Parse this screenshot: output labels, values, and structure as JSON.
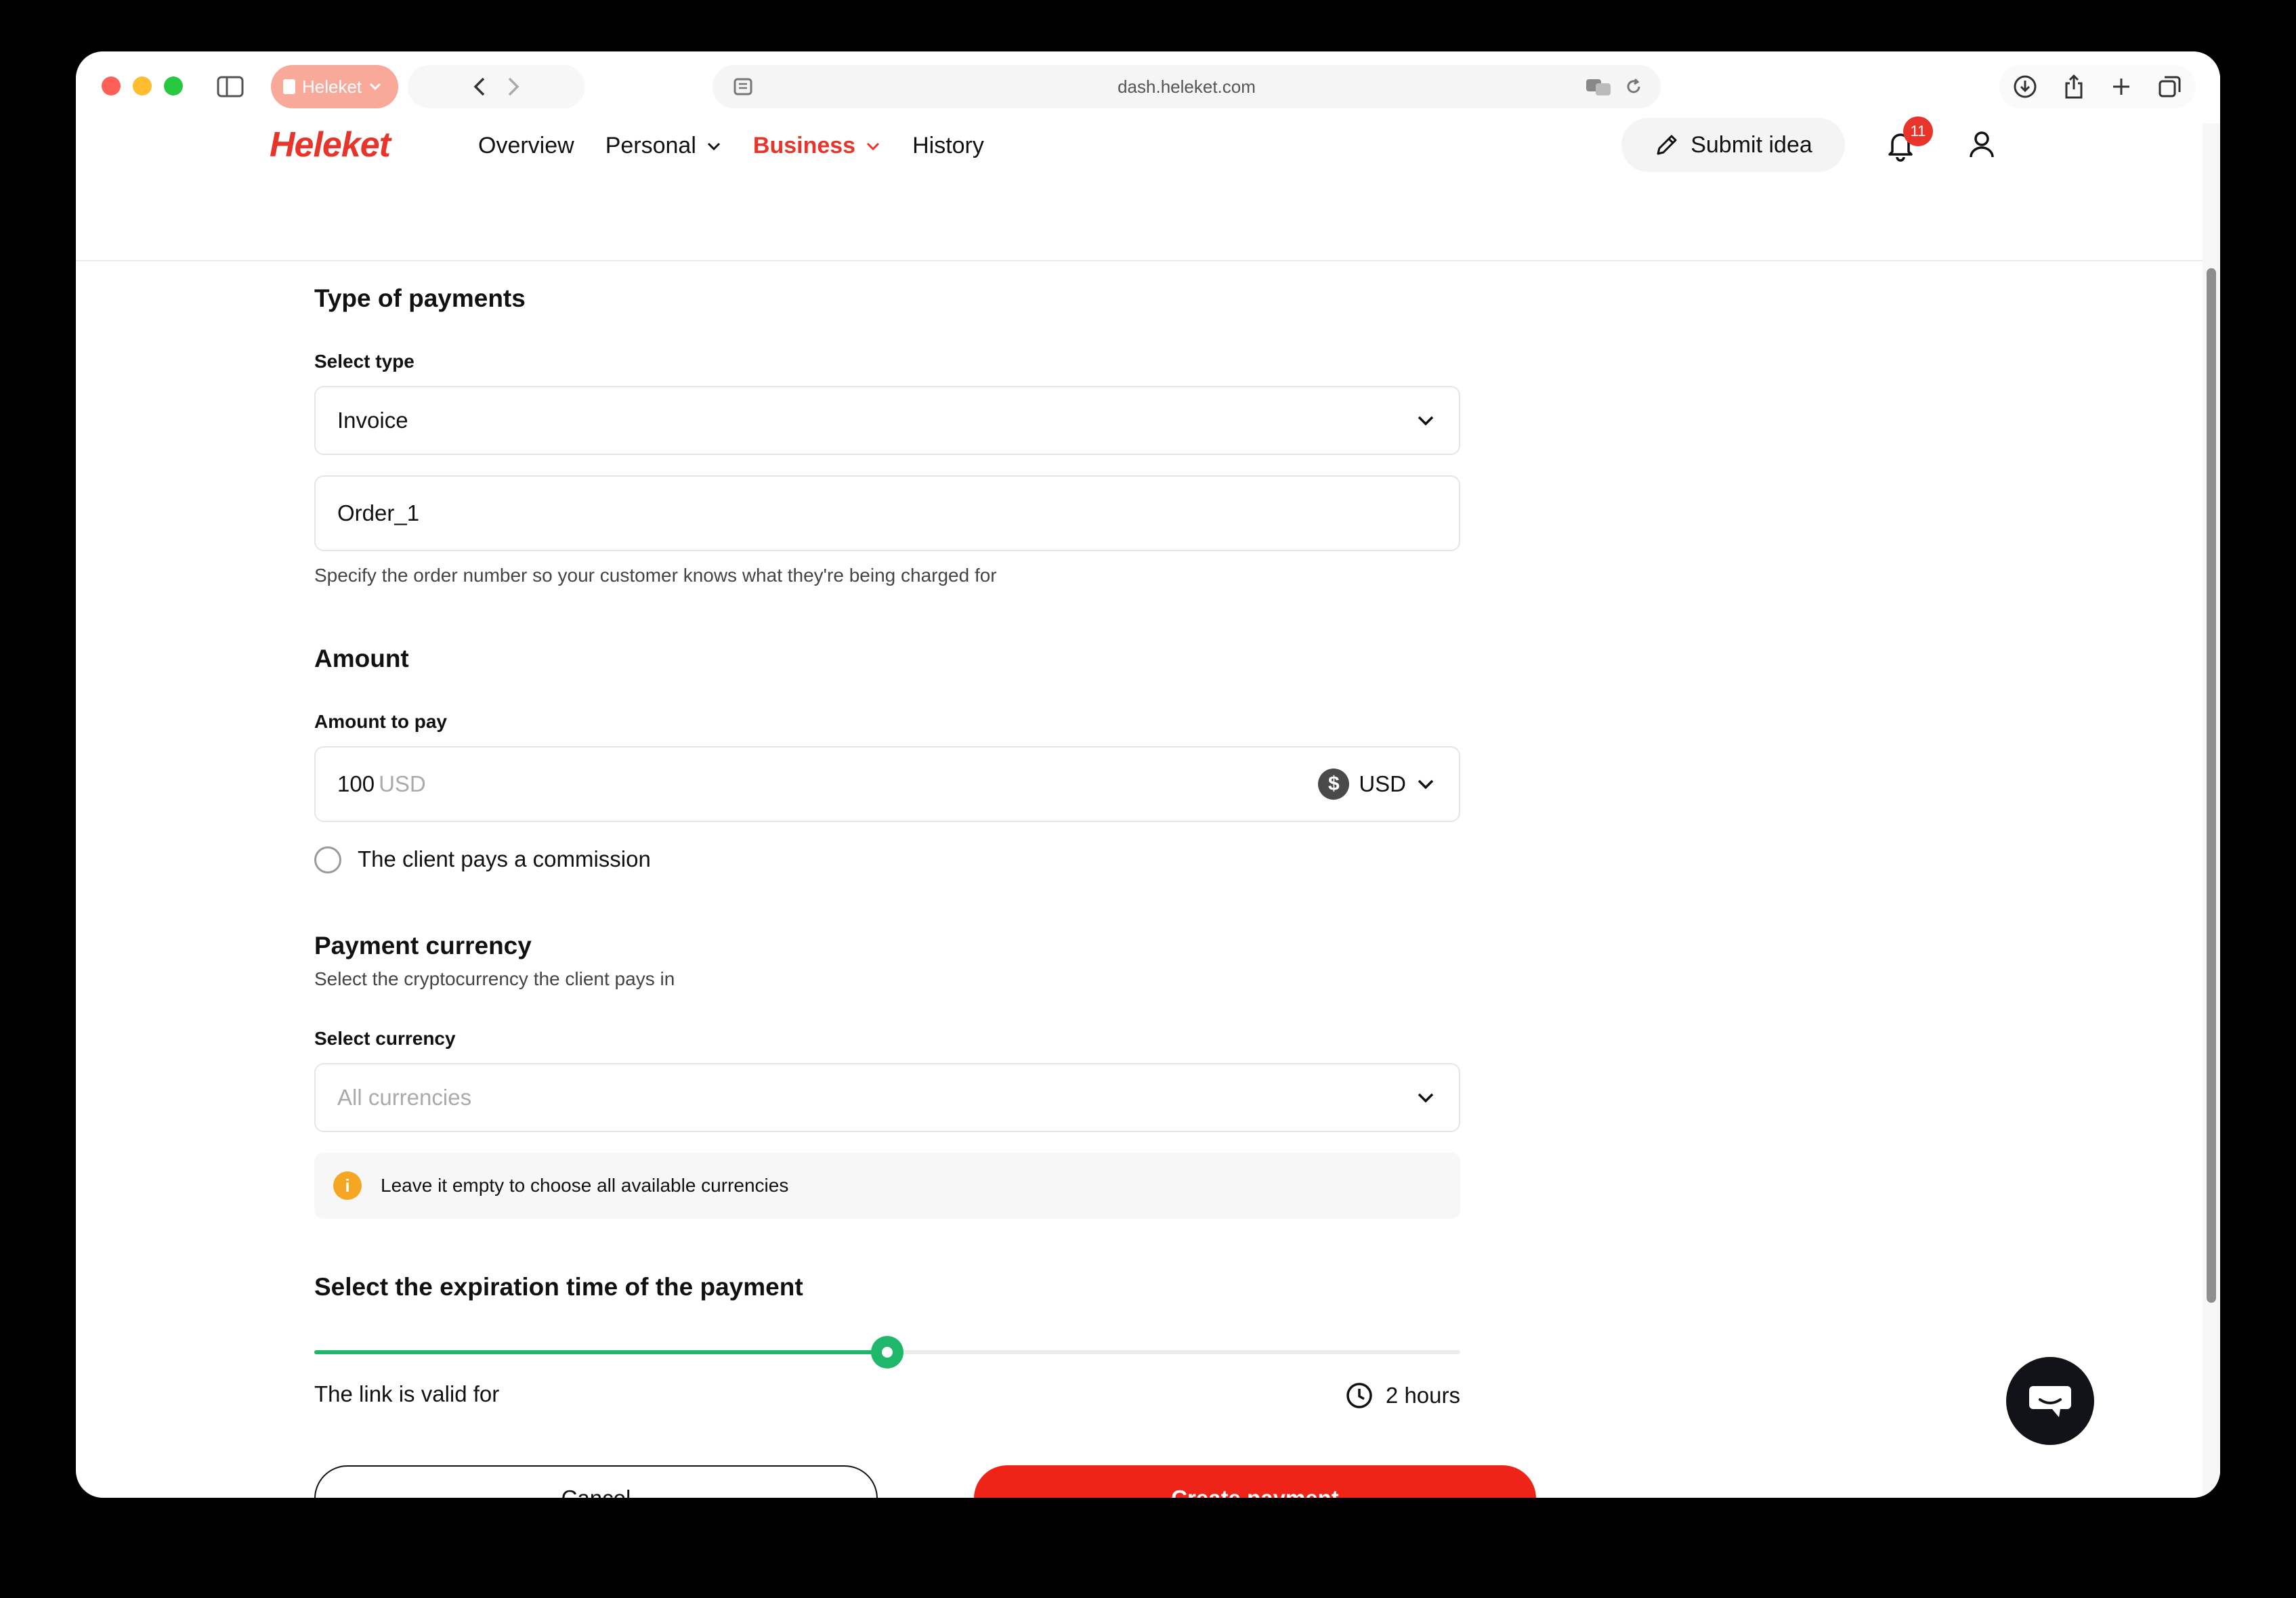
{
  "browser": {
    "profile_label": "Heleket",
    "url": "dash.heleket.com"
  },
  "header": {
    "logo": "Heleket",
    "nav": [
      {
        "label": "Overview"
      },
      {
        "label": "Personal"
      },
      {
        "label": "Business"
      },
      {
        "label": "History"
      }
    ],
    "submit_idea_label": "Submit idea",
    "notification_count": "11"
  },
  "form": {
    "type_section_title": "Type of payments",
    "select_type_label": "Select type",
    "select_type_value": "Invoice",
    "order_value": "Order_1",
    "order_hint": "Specify the order number so your customer knows what they're being charged for",
    "amount_section_title": "Amount",
    "amount_label": "Amount to pay",
    "amount_value": "100",
    "amount_unit_placeholder": "USD",
    "amount_currency": "USD",
    "commission_label": "The client pays a commission",
    "payment_currency_title": "Payment currency",
    "payment_currency_subtitle": "Select the cryptocurrency the client pays in",
    "select_currency_label": "Select currency",
    "select_currency_placeholder": "All currencies",
    "info_text": "Leave it empty to choose all available currencies",
    "expiration_title": "Select the expiration time of the payment",
    "expiration_slider_fraction": 0.5,
    "valid_for_label": "The link is valid for",
    "valid_for_value": "2 hours",
    "cancel_label": "Cancel",
    "create_label": "Create payment"
  },
  "colors": {
    "brand_red": "#e8352b",
    "slider_green": "#1fb86b",
    "create_button": "#ee2419"
  }
}
